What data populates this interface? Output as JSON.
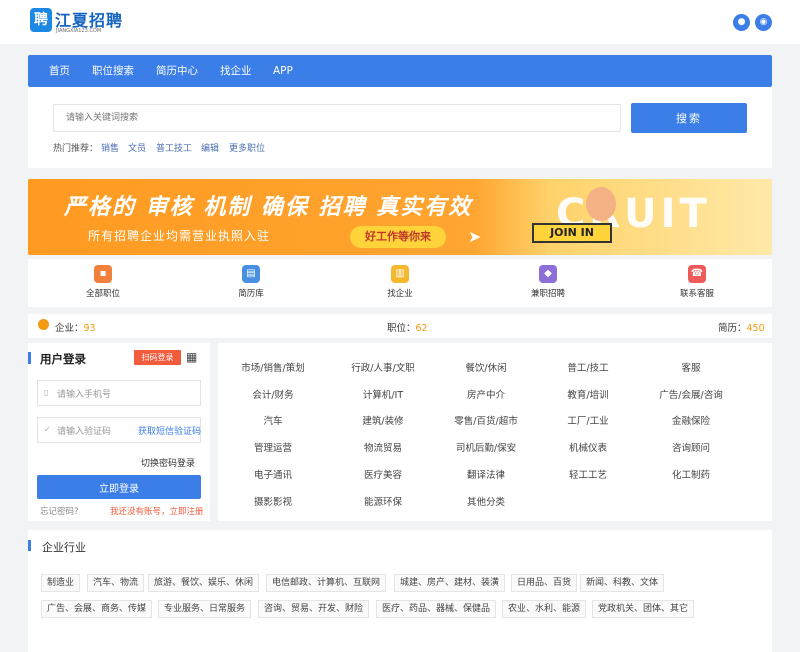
{
  "header": {
    "logo_glyph": "聘",
    "logo_title": "江夏招聘",
    "logo_sub": "JIANGXIA123.COM",
    "icons": [
      "user-icon",
      "location-icon"
    ],
    "accent": "#3b7ee8"
  },
  "nav": {
    "items": [
      "首页",
      "职位搜索",
      "简历中心",
      "找企业",
      "APP"
    ]
  },
  "search": {
    "placeholder": "请输入关键词搜索",
    "button": "搜索",
    "hot_label": "热门推荐：",
    "hot": [
      "销售",
      "文员",
      "普工技工",
      "编辑",
      "更多职位"
    ]
  },
  "banner": {
    "headline": "严格的 审核 机制  确保 招聘 真实有效",
    "subline": "所有招聘企业均需营业执照入驻",
    "pill": "好工作等你来",
    "join": "JOIN IN",
    "recruit": "CRUIT"
  },
  "categories": [
    {
      "label": "全部职位",
      "icon": "briefcase-icon",
      "color": "#f0803c"
    },
    {
      "label": "简历库",
      "icon": "document-icon",
      "color": "#4a90e2"
    },
    {
      "label": "找企业",
      "icon": "building-icon",
      "color": "#f5b82e"
    },
    {
      "label": "兼职招聘",
      "icon": "handshake-icon",
      "color": "#8e6fd8"
    },
    {
      "label": "联系客服",
      "icon": "headset-icon",
      "color": "#ef5a5a"
    }
  ],
  "stats": {
    "company_label": "企业：",
    "company_value": "93",
    "job_label": "职位：",
    "job_value": "62",
    "resume_label": "简历：",
    "resume_value": "450"
  },
  "login": {
    "title": "用户登录",
    "scan": "扫码登录",
    "phone_placeholder": "请输入手机号",
    "code_placeholder": "请输入验证码",
    "sms": "获取短信验证码",
    "pwd_login": "切换密码登录",
    "button": "立即登录",
    "forgot": "忘记密码?",
    "register": "我还没有账号，立即注册"
  },
  "job_categories": [
    [
      "市场/销售/策划",
      "行政/人事/文职",
      "餐饮/休闲",
      "普工/技工",
      "客服"
    ],
    [
      "会计/财务",
      "计算机/IT",
      "房产中介",
      "教育/培训",
      "广告/会展/咨询"
    ],
    [
      "汽车",
      "建筑/装修",
      "零售/百货/超市",
      "工厂/工业",
      "金融保险"
    ],
    [
      "管理运营",
      "物流贸易",
      "司机后勤/保安",
      "机械仪表",
      "咨询顾问"
    ],
    [
      "电子通讯",
      "医疗美容",
      "翻译法律",
      "轻工工艺",
      "化工制药"
    ],
    [
      "摄影影视",
      "能源环保",
      "其他分类"
    ]
  ],
  "industry": {
    "title": "企业行业",
    "row1": [
      "制造业",
      "汽车、物流",
      "旅游、餐饮、娱乐、休闲",
      "电信邮政、计算机、互联网",
      "城建、房产、建材、装潢",
      "日用品、百货",
      "新闻、科教、文体"
    ],
    "row2": [
      "广告、会展、商务、传媒",
      "专业服务、日常服务",
      "咨询、贸易、开发、财险",
      "医疗、药品、器械、保健品",
      "农业、水利、能源",
      "党政机关、团体、其它"
    ]
  }
}
